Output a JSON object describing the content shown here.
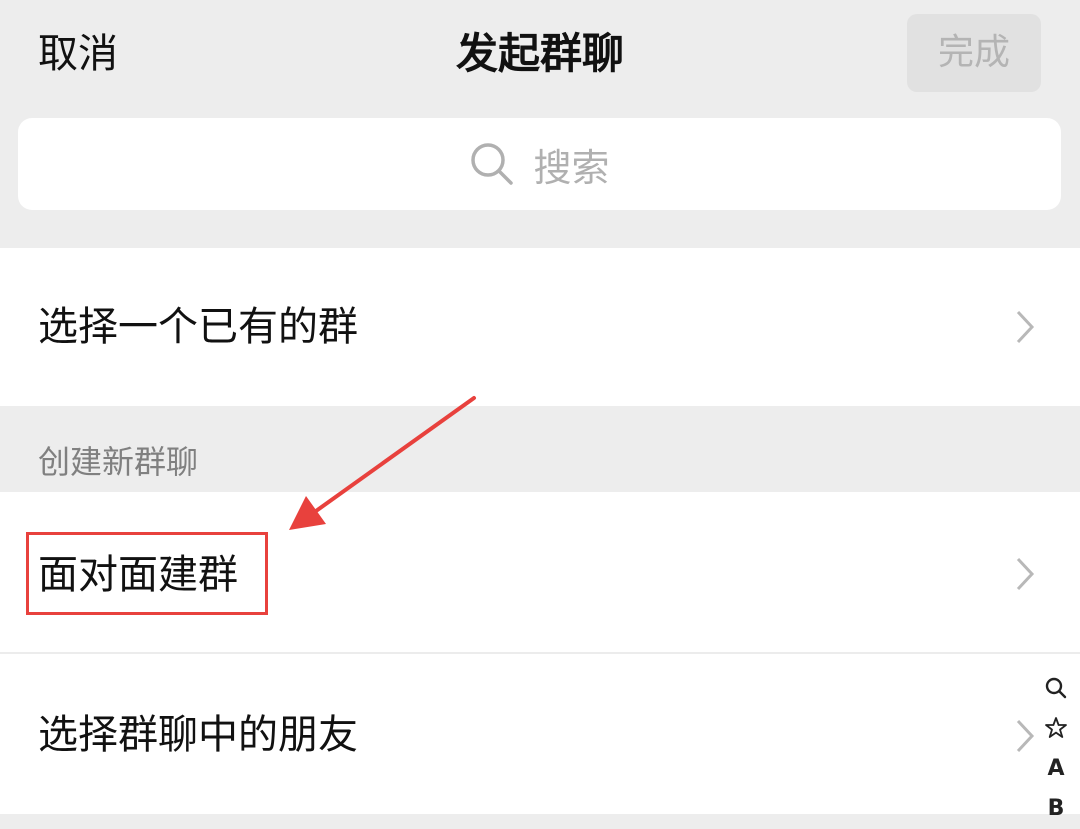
{
  "header": {
    "cancel_label": "取消",
    "title": "发起群聊",
    "done_label": "完成"
  },
  "search": {
    "placeholder": "搜索",
    "icon": "search-icon"
  },
  "list": {
    "existing_group_label": "选择一个已有的群",
    "section_title": "创建新群聊",
    "face_to_face_label": "面对面建群",
    "friends_in_group_label": "选择群聊中的朋友"
  },
  "index_bar": {
    "items": [
      "star-icon",
      "A",
      "B"
    ]
  },
  "colors": {
    "background": "#ededed",
    "surface": "#ffffff",
    "annotation": "#e8413d",
    "done_disabled_bg": "#e1e1e1",
    "done_disabled_text": "#b4b4b4"
  }
}
